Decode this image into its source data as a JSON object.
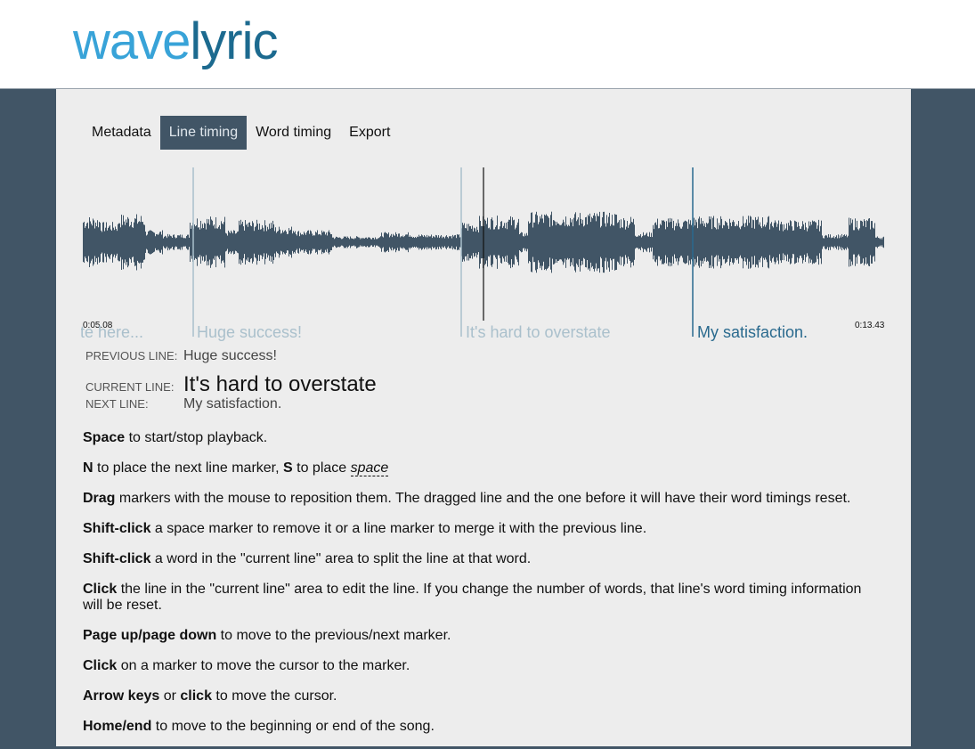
{
  "app": {
    "logo_part1": "wave",
    "logo_part2": "lyric"
  },
  "tabs": [
    {
      "label": "Metadata",
      "active": false
    },
    {
      "label": "Line timing",
      "active": true
    },
    {
      "label": "Word timing",
      "active": false
    },
    {
      "label": "Export",
      "active": false
    }
  ],
  "waveform": {
    "start_time": "0:05.08",
    "end_time": "0:13.43",
    "lyric_markers": [
      {
        "text": "...te here:"
      },
      {
        "text": "Huge success!"
      },
      {
        "text": "It's hard to overstate"
      },
      {
        "text": "My satisfaction."
      }
    ],
    "colors": {
      "wave": "#415566",
      "marker": "#a9c0cc",
      "cursor": "#111111",
      "next_marker": "#2a6a8e"
    }
  },
  "lines": {
    "previous_label": "PREVIOUS LINE:",
    "previous_value": "Huge success!",
    "current_label": "CURRENT LINE:",
    "current_value": "It's hard to overstate",
    "next_label": "NEXT LINE:",
    "next_value": "My satisfaction."
  },
  "help": {
    "space_key": "Space",
    "space_text": " to start/stop playback.",
    "n_key": "N",
    "n_text": " to place the next line marker, ",
    "s_key": "S",
    "s_text": " to place ",
    "space_word": "space",
    "drag_key": "Drag",
    "drag_text": " markers with the mouse to reposition them. The dragged line and the one before it will have their word timings reset.",
    "shift1_key": "Shift-click",
    "shift1_text": " a space marker to remove it or a line marker to merge it with the previous line.",
    "shift2_key": "Shift-click",
    "shift2_text": " a word in the \"current line\" area to split the line at that word.",
    "click1_key": "Click",
    "click1_text": " the line in the \"current line\" area to edit the line. If you change the number of words, that line's word timing information will be reset.",
    "page_key": "Page up/page down",
    "page_text": " to move to the previous/next marker.",
    "click2_key": "Click",
    "click2_text": " on a marker to move the cursor to the marker.",
    "arrow_key": "Arrow keys",
    "arrow_mid": " or ",
    "arrow_key2": "click",
    "arrow_text": " to move the cursor.",
    "home_key": "Home/end",
    "home_text": " to move to the beginning or end of the song."
  }
}
